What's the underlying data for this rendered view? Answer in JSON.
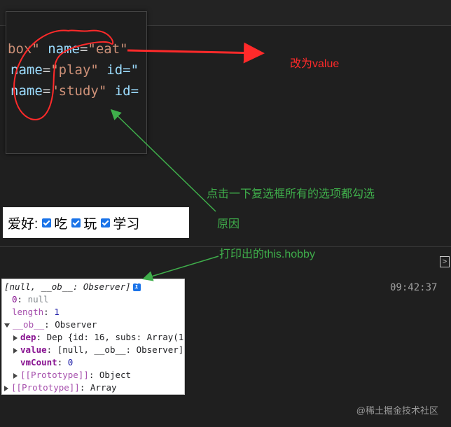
{
  "code": {
    "line1": {
      "pre": "box\" ",
      "attr": "name",
      "eq": "=",
      "val": "\"eat\""
    },
    "line2": {
      "attr": "name",
      "eq": "=",
      "val": "\"play\"",
      "attr2": " id=\""
    },
    "line3": {
      "attr": "name",
      "eq": "=",
      "val": "\"study\"",
      "attr2": " id="
    }
  },
  "annotations": {
    "change_to_value": "改为value",
    "click_note": "点击一下复选框所有的选项都勾选",
    "reason": "原因",
    "printed": "打印出的this.hobby"
  },
  "hobby": {
    "label": "爱好:",
    "options": [
      "吃",
      "玩",
      "学习"
    ],
    "checked": [
      true,
      true,
      true
    ]
  },
  "console": {
    "timestamp": "09:42:37",
    "header": "[null, __ob__: Observer]",
    "info_badge": "i",
    "rows": {
      "r0_key": "0",
      "r0_val": "null",
      "length_key": "length",
      "length_val": "1",
      "ob_key": "__ob__",
      "ob_val": "Observer",
      "dep_key": "dep",
      "dep_val": "Dep {id: 16, subs: Array(1)",
      "value_key": "value",
      "value_val": "[null, __ob__: Observer]",
      "vm_key": "vmCount",
      "vm_val": "0",
      "proto1_key": "[[Prototype]]",
      "proto1_val": "Object",
      "proto2_key": "[[Prototype]]",
      "proto2_val": "Array"
    }
  },
  "watermark": "@稀土掘金技术社区",
  "colors": {
    "red": "#ff2a2a",
    "green": "#3fae4b",
    "accent": "#1a73e8"
  }
}
